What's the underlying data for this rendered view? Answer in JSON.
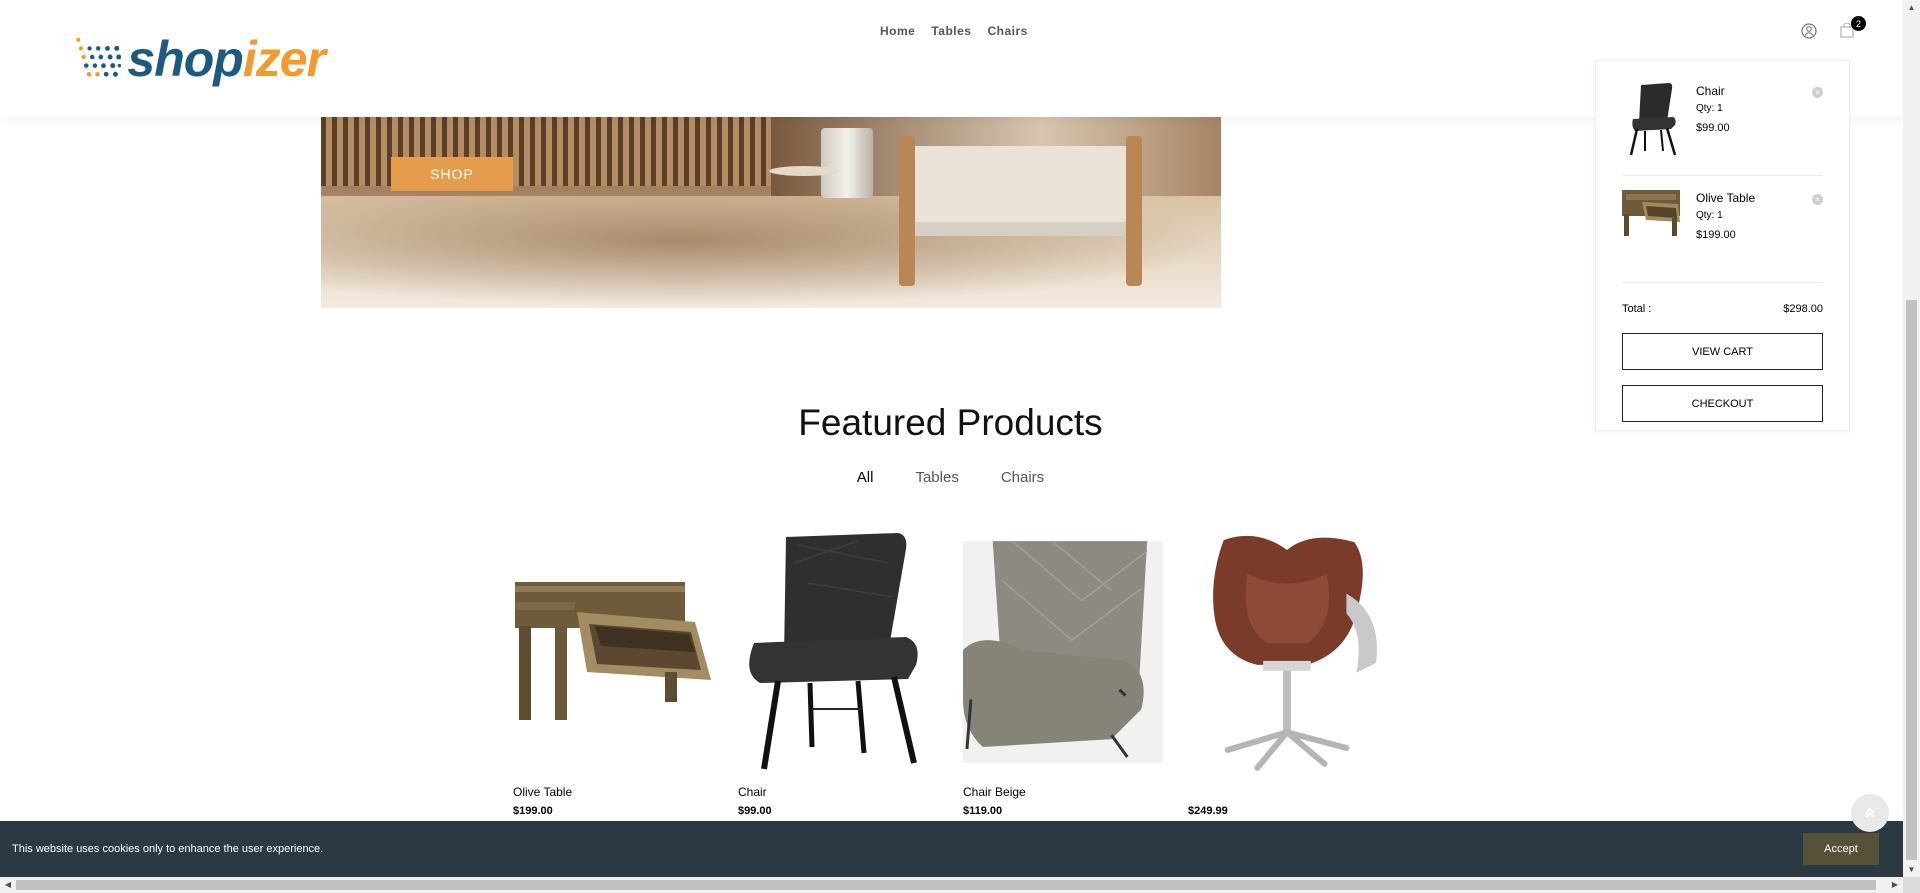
{
  "brand": {
    "part1": "shop",
    "part2": "izer",
    "colors": {
      "primary": "#1c5a80",
      "accent": "#f29a2e"
    }
  },
  "nav": {
    "items": [
      {
        "label": "Home"
      },
      {
        "label": "Tables"
      },
      {
        "label": "Chairs"
      }
    ]
  },
  "header_icons": {
    "account": "user-icon",
    "cart": "shopping-bag-icon",
    "cart_count": "2"
  },
  "hero": {
    "shop_label": "SHOP"
  },
  "mini_cart": {
    "items": [
      {
        "name": "Chair",
        "qty": "Qty: 1",
        "price": "$99.00",
        "thumb": "black-chair"
      },
      {
        "name": "Olive Table",
        "qty": "Qty: 1",
        "price": "$199.00",
        "thumb": "wood-table"
      }
    ],
    "total_label": "Total :",
    "total_value": "$298.00",
    "view_cart_label": "VIEW CART",
    "checkout_label": "CHECKOUT"
  },
  "featured": {
    "title": "Featured Products",
    "tabs": [
      {
        "label": "All",
        "active": true
      },
      {
        "label": "Tables"
      },
      {
        "label": "Chairs"
      }
    ],
    "products": [
      {
        "name": "Olive Table",
        "price": "$199.00"
      },
      {
        "name": "Chair",
        "price": "$99.00"
      },
      {
        "name": "Chair Beige",
        "price": "$119.00"
      },
      {
        "name": "",
        "price": "$249.99"
      }
    ]
  },
  "cookie": {
    "message": "This website uses cookies only to enhance the user experience.",
    "accept_label": "Accept"
  }
}
